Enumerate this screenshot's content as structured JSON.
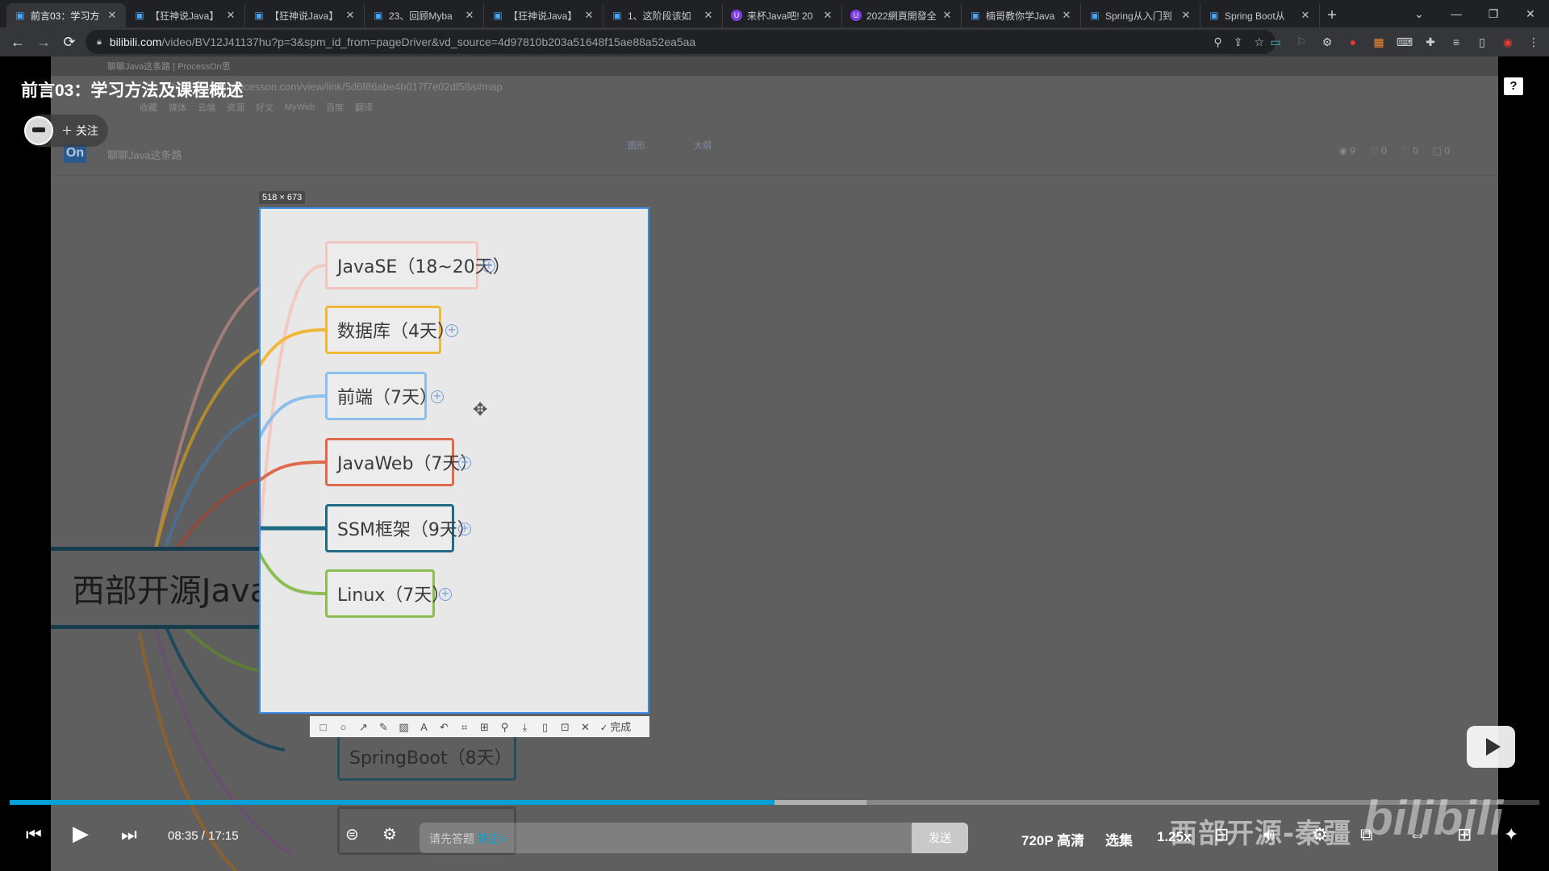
{
  "browser": {
    "tabs": [
      {
        "title": "前言03：学习方",
        "active": true,
        "icon": "bilibili-tv-icon"
      },
      {
        "title": "【狂神说Java】",
        "icon": "bilibili-tv-icon"
      },
      {
        "title": "【狂神说Java】",
        "icon": "bilibili-tv-icon"
      },
      {
        "title": "23、回顾Myba",
        "icon": "bilibili-tv-icon"
      },
      {
        "title": "【狂神说Java】",
        "icon": "bilibili-tv-icon"
      },
      {
        "title": "1、这阶段该如",
        "icon": "bilibili-tv-icon"
      },
      {
        "title": "来杯Java吧! 20",
        "icon": "purple-circle-icon"
      },
      {
        "title": "2022網頁開發全",
        "icon": "purple-circle-icon"
      },
      {
        "title": "楠哥教你学Java",
        "icon": "bilibili-tv-icon"
      },
      {
        "title": "Spring从入门到",
        "icon": "bilibili-tv-icon"
      },
      {
        "title": "Spring Boot从",
        "icon": "bilibili-tv-icon"
      }
    ],
    "url_host": "bilibili.com",
    "url_path": "/video/BV12J41137hu?p=3&spm_id_from=pageDriver&vd_source=4d97810b203a51648f15ae88a52ea5aa"
  },
  "inner": {
    "tab_title": "聊聊Java这条路 | ProcessOn思",
    "url": "https://www.processon.com/view/link/5d6f86abe4b017f7e02df58a#map",
    "bookmarks": [
      "收藏",
      "媒体",
      "云端",
      "资源",
      "好文",
      "MyWeb",
      "百度",
      "翻译"
    ],
    "logo": "On",
    "doc_title": "聊聊Java这条路",
    "view_tabs": [
      "图形",
      "大纲"
    ],
    "stats": [
      "9",
      "0",
      "0",
      "0"
    ]
  },
  "mindmap": {
    "root": "西部开源Java",
    "selection_size": "518 × 673",
    "nodes": [
      {
        "label": "JavaSE（18~20天）",
        "color": "#f1c5c0"
      },
      {
        "label": "数据库（4天）",
        "color": "#efb838"
      },
      {
        "label": "前端（7天）",
        "color": "#8cbfee"
      },
      {
        "label": "JavaWeb（7天）",
        "color": "#de6a4e"
      },
      {
        "label": "SSM框架（9天）",
        "color": "#1f6a85"
      },
      {
        "label": "Linux（7天）",
        "color": "#8bbd52"
      }
    ],
    "below_node": "SpringBoot（8天）",
    "snip_done": "完成"
  },
  "player": {
    "title": "前言03：学习方法及课程概述",
    "follow": "关注",
    "help": "?",
    "time_current": "08:35",
    "time_separator": "/",
    "time_total": "17:15",
    "progress_played": 0.5,
    "progress_buffered": 0.56,
    "danmaku_placeholder": "请先答题",
    "danmaku_link": "转正>",
    "send": "发送",
    "quality": "720P 高清",
    "episodes": "选集",
    "speed": "1.25x",
    "watermark": "西部开源-秦疆",
    "watermark_logo": "bilibili"
  },
  "colors": {
    "accent": "#00a1d6",
    "selection": "#3a8be3"
  }
}
